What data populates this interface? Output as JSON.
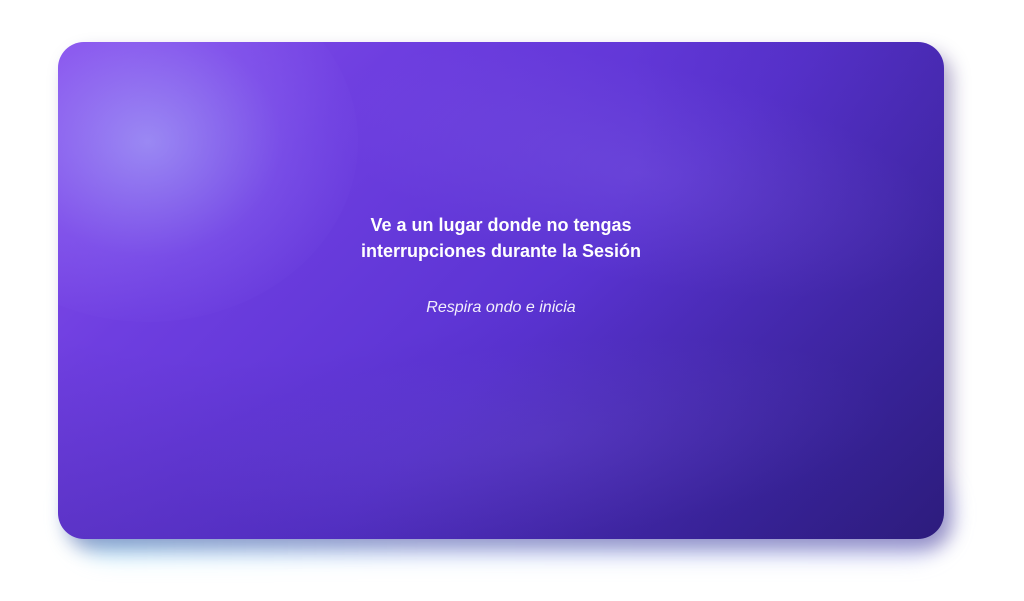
{
  "card": {
    "title_line1": "Ve a un lugar donde no tengas",
    "title_line2": "interrupciones durante la Sesión",
    "subtitle": "Respira ondo e inicia"
  },
  "colors": {
    "background": "#ffffff",
    "card_top_left": "#8a52ec",
    "card_center": "#5a33d2",
    "card_bottom_right": "#35228f",
    "text": "#ffffff"
  }
}
